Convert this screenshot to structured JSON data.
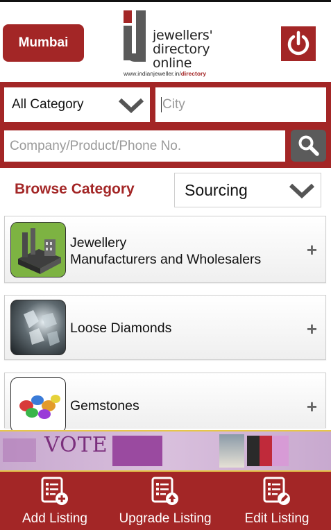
{
  "header": {
    "city_button": "Mumbai",
    "logo": {
      "line1": "jewellers'",
      "line2": "directory",
      "line3": "online",
      "url_prefix": "www.indianjeweller.in/",
      "url_suffix": "directory"
    },
    "power_icon": "power-icon"
  },
  "search": {
    "category_value": "All Category",
    "city_placeholder": "City",
    "query_placeholder": "Company/Product/Phone No.",
    "search_icon": "search-icon"
  },
  "browse": {
    "title": "Browse Category",
    "sourcing_value": "Sourcing"
  },
  "categories": [
    {
      "label_line1": "Jewellery",
      "label_line2": "Manufacturers and Wholesalers",
      "thumb": "factory-image"
    },
    {
      "label_line1": "Loose Diamonds",
      "label_line2": "",
      "thumb": "diamonds-image"
    },
    {
      "label_line1": "Gemstones",
      "label_line2": "",
      "thumb": "gemstones-image"
    }
  ],
  "banner": {
    "headline": "VOTE"
  },
  "bottom_nav": [
    {
      "label": "Add Listing",
      "icon": "add-listing-icon"
    },
    {
      "label": "Upgrade Listing",
      "icon": "upgrade-listing-icon"
    },
    {
      "label": "Edit Listing",
      "icon": "edit-listing-icon"
    }
  ],
  "colors": {
    "brand_red": "#a32626",
    "gray_button": "#5b5b5b"
  }
}
